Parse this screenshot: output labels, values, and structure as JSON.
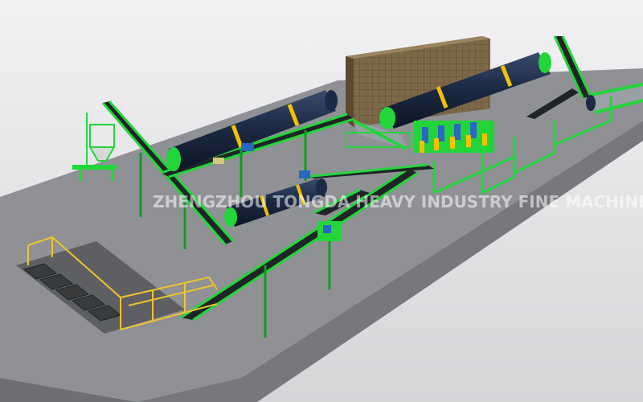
{
  "scene": {
    "description_visible": false,
    "watermark": {
      "main_text": "ZHENGZHOU TONGDA HEAVY INDUSTRY  FINE MACHINE",
      "sub_text": "FINE MACHINE"
    },
    "colors": {
      "background_top": "#f2f2f4",
      "background_bottom": "#d6d6d9",
      "floor": "#8f9195",
      "floor_edge": "#6d6f73",
      "steel_green": "#22d63a",
      "steel_green_dark": "#129a24",
      "drum_navy": "#1c2a44",
      "drum_ring": "#f2c200",
      "belt_black": "#1f2426",
      "railing_yellow": "#f0c42c",
      "storage_box": "#6e5a3e"
    }
  }
}
